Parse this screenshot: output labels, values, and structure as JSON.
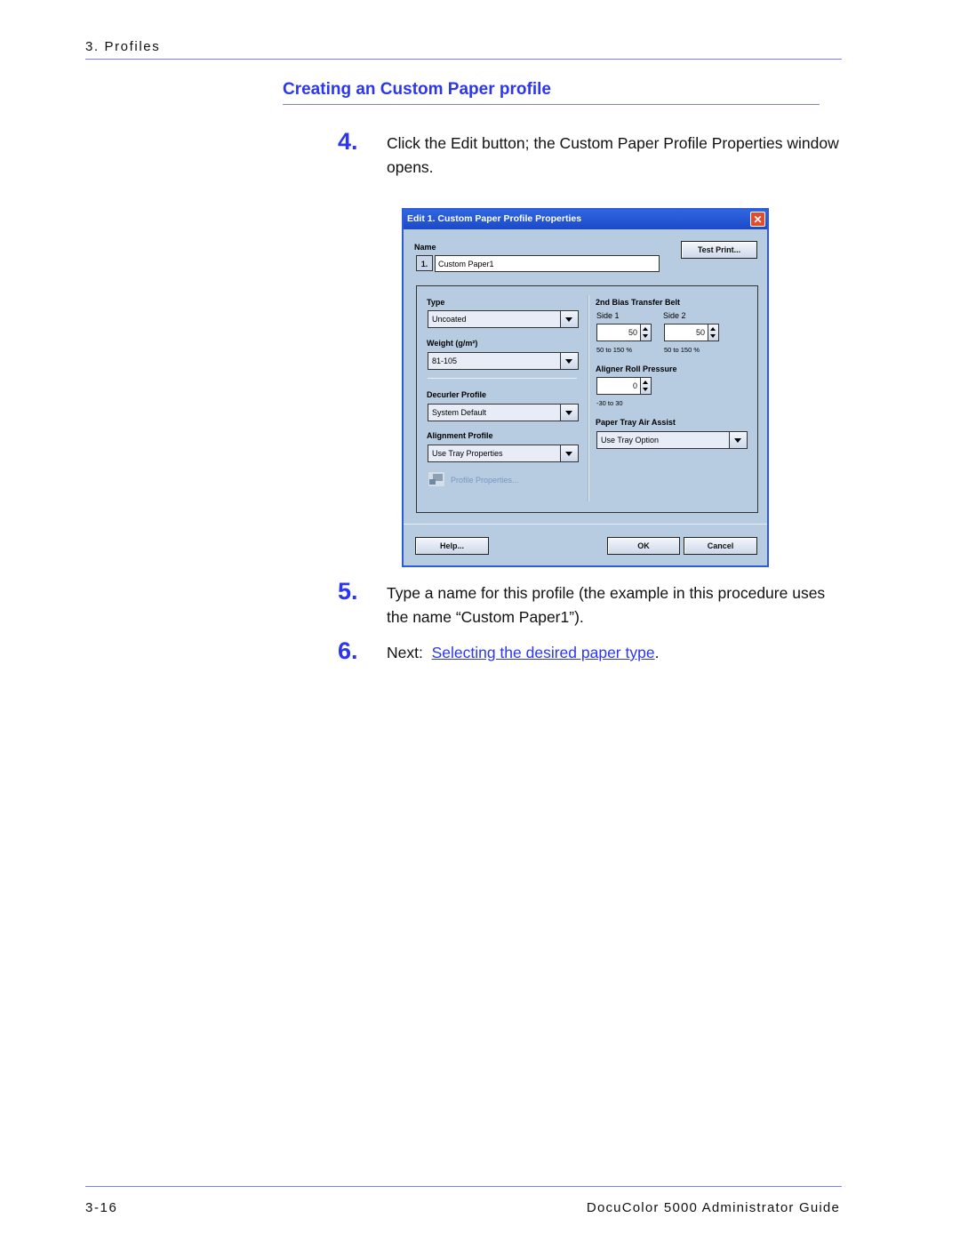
{
  "header": {
    "running_head": "3. Profiles"
  },
  "section": {
    "title": "Creating an Custom Paper profile"
  },
  "steps": [
    {
      "num": "4.",
      "text": "Click the Edit button; the Custom Paper Profile Properties window opens."
    },
    {
      "num": "5.",
      "text": "Type a name for this profile (the example in this procedure uses the name “Custom Paper1”)."
    },
    {
      "num": "6.",
      "prefix": "Next:  ",
      "link": "Selecting the desired paper type",
      "suffix": "."
    }
  ],
  "dialog": {
    "title": "Edit 1. Custom Paper Profile Properties",
    "close_icon": "close-x-icon",
    "name_label": "Name",
    "name_number": "1.",
    "name_value": "Custom Paper1",
    "test_print_label": "Test Print...",
    "type_label": "Type",
    "type_value": "Uncoated",
    "weight_label": "Weight (g/m²)",
    "weight_value": "81-105",
    "decurler_label": "Decurler Profile",
    "decurler_value": "System Default",
    "alignment_label": "Alignment Profile",
    "alignment_value": "Use Tray Properties",
    "profile_properties_label": "Profile Properties...",
    "bias_belt_label": "2nd Bias Transfer Belt",
    "side1_label": "Side 1",
    "side1_value": "50",
    "side1_range": "50 to 150 %",
    "side2_label": "Side 2",
    "side2_value": "50",
    "side2_range": "50 to 150 %",
    "aligner_label": "Aligner Roll Pressure",
    "aligner_value": "0",
    "aligner_range": "-30 to 30",
    "air_assist_label": "Paper Tray Air Assist",
    "air_assist_value": "Use Tray Option",
    "help_label": "Help...",
    "ok_label": "OK",
    "cancel_label": "Cancel"
  },
  "footer": {
    "page_number": "3-16",
    "guide_title": "DocuColor 5000 Administrator Guide"
  }
}
